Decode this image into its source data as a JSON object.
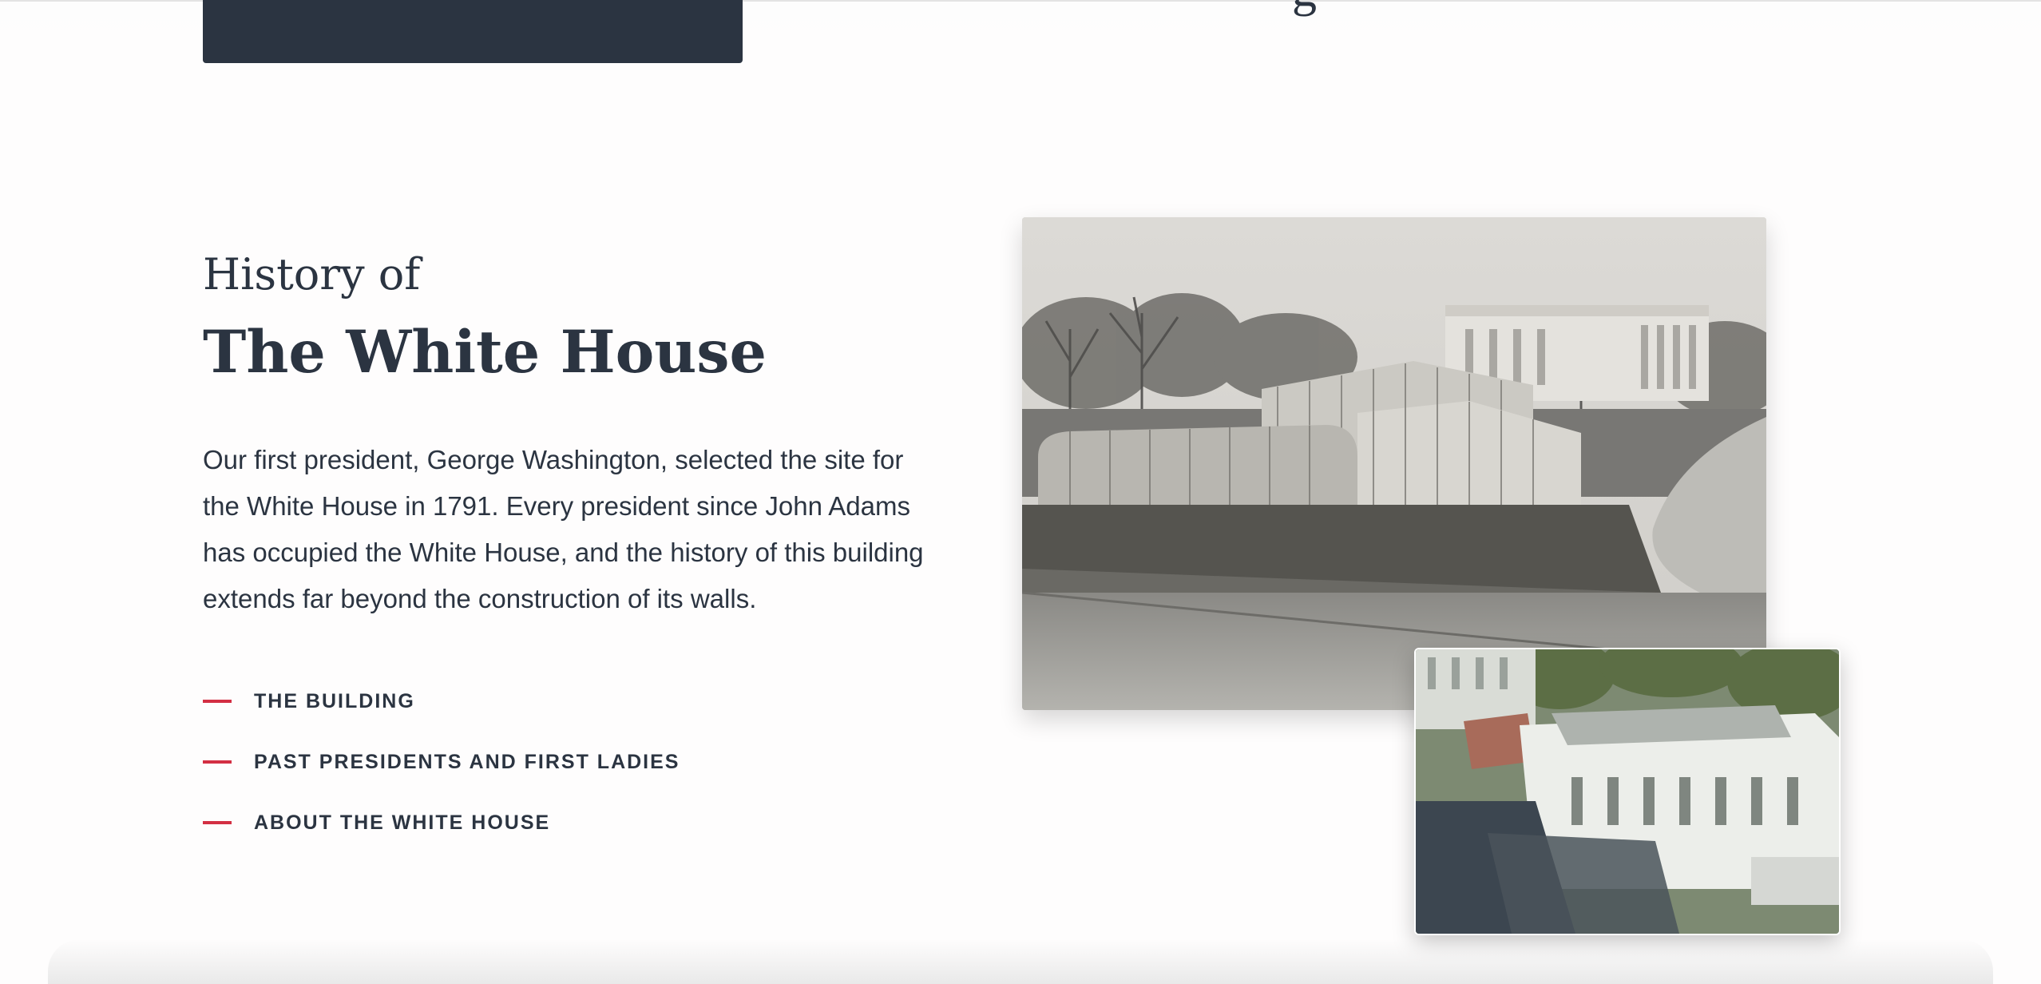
{
  "top_bar": {
    "partial_glyph": "g"
  },
  "history": {
    "eyebrow": "History of",
    "title": "The White House",
    "intro": "Our first president, George Washington, selected the site for the White House in 1791. Every president since John Adams has occupied the White House, and the history of this building extends far beyond the construction of its walls.",
    "links": [
      {
        "label": "THE BUILDING"
      },
      {
        "label": "PAST PRESIDENTS AND FIRST LADIES"
      },
      {
        "label": "ABOUT THE WHITE HOUSE"
      }
    ]
  },
  "colors": {
    "text": "#2b3441",
    "accent": "#d32f43",
    "dark_block": "#2b3441",
    "background": "#fefdfd"
  },
  "images": {
    "main": "historic-greenhouses-photo",
    "inset": "aerial-white-house-photo"
  }
}
